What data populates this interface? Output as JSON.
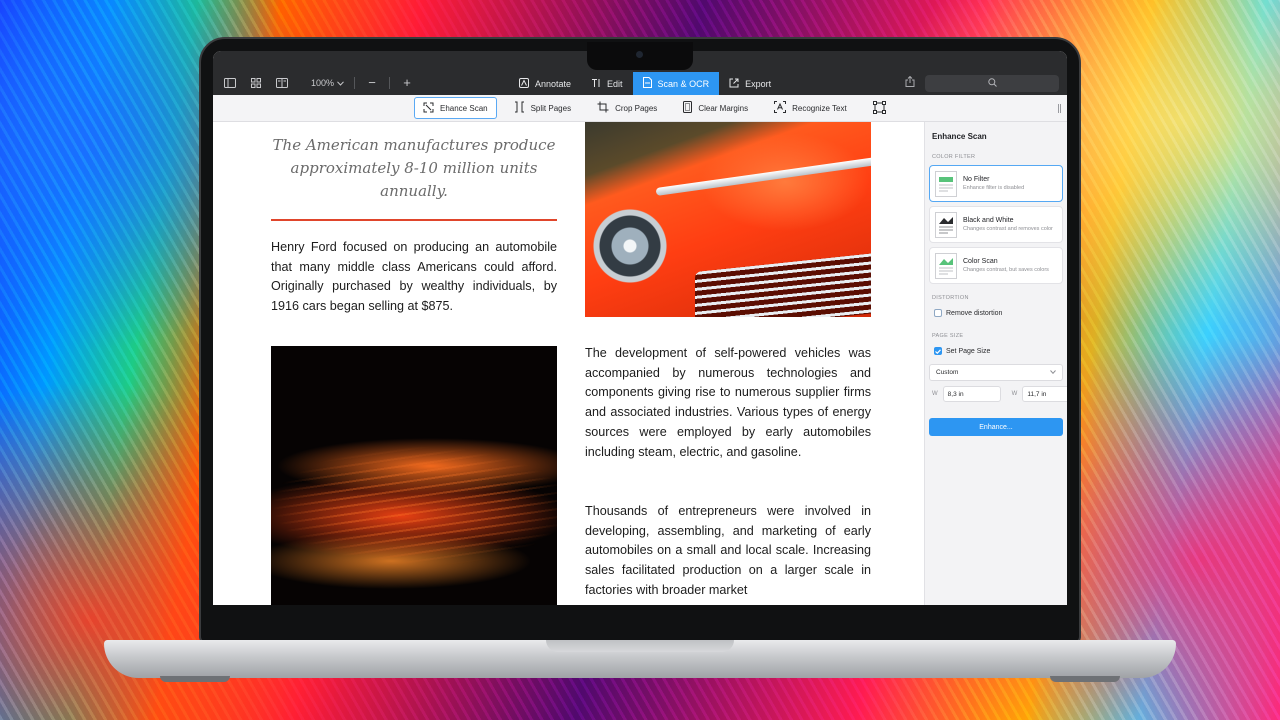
{
  "titlebar": {
    "zoom_label": "100%",
    "zoom_minus": "−",
    "zoom_plus": "+",
    "mode_tabs": [
      {
        "label": "Annotate",
        "icon": "annotate-icon",
        "active": false
      },
      {
        "label": "Edit",
        "icon": "text-edit-icon",
        "active": false
      },
      {
        "label": "Scan & OCR",
        "icon": "scan-document-icon",
        "active": true
      },
      {
        "label": "Export",
        "icon": "export-icon",
        "active": false
      }
    ],
    "search_icon": "search-icon",
    "share_icon": "share-icon"
  },
  "toolbar": {
    "tools": [
      {
        "label": "Ehance Scan",
        "icon": "enhance-scan-icon",
        "active": true
      },
      {
        "label": "Split Pages",
        "icon": "split-pages-icon",
        "active": false
      },
      {
        "label": "Crop Pages",
        "icon": "crop-icon",
        "active": false
      },
      {
        "label": "Clear Margins",
        "icon": "clear-margins-icon",
        "active": false
      },
      {
        "label": "Recognize Text",
        "icon": "recognize-text-icon",
        "active": false
      }
    ],
    "selection_icon": "selection-frame-icon"
  },
  "document": {
    "quote": "The American manufactures produce approximately 8-10 million units annually.",
    "paragraph_1": "Henry Ford focused on producing an automobile that many middle class Americans could afford. Originally purchased by wealthy individuals, by 1916 cars began selling at $875.",
    "paragraph_2": "The development of self-powered vehicles was accompanied by numerous technologies and components giving rise to numerous supplier firms and associated industries. Various types of energy sources were employed by early automobiles including steam, electric, and gasoline.",
    "paragraph_3": "Thousands of entrepreneurs were involved in developing, assembling, and marketing of early automobiles on a small and local scale. Increasing sales facilitated production on a larger scale in factories with broader market"
  },
  "side_panel": {
    "title": "Enhance Scan",
    "color_filter_section": "COLOR FILTER",
    "filters": [
      {
        "name": "No Filter",
        "desc": "Enhance filter is disabled",
        "selected": true
      },
      {
        "name": "Black and White",
        "desc": "Changes contrast and removes color",
        "selected": false
      },
      {
        "name": "Color Scan",
        "desc": "Changes contrast, but saves colors",
        "selected": false
      }
    ],
    "distortion_section": "DISTORTION",
    "remove_distortion_label": "Remove distortion",
    "remove_distortion_checked": false,
    "page_size_section": "PAGE SIZE",
    "set_page_size_label": "Set Page Size",
    "set_page_size_checked": true,
    "page_size_value": "Custom",
    "width_label": "W",
    "width_value": "8,3 in",
    "height_label": "W",
    "height_value": "11,7 in",
    "enhance_button": "Enhance..."
  },
  "colors": {
    "accent": "#2d96f2",
    "quote_rule": "#e0452b",
    "titlebar": "#2b2c2e"
  }
}
